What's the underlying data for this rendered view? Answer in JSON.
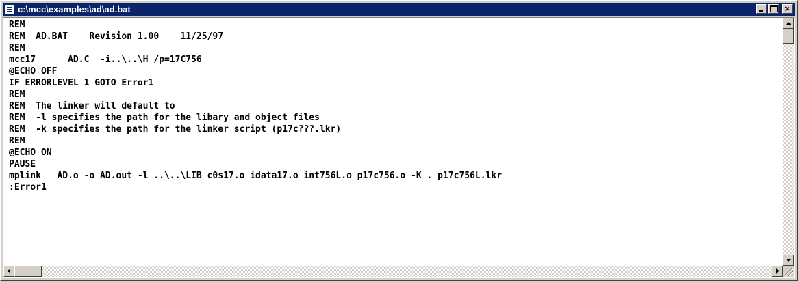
{
  "window": {
    "title": "c:\\mcc\\examples\\ad\\ad.bat",
    "icon": "notepad-icon",
    "buttons": {
      "minimize": "minimize-icon",
      "maximize": "maximize-icon",
      "close": "×"
    }
  },
  "editor": {
    "lines": [
      "REM",
      "REM  AD.BAT    Revision 1.00    11/25/97",
      "REM",
      "mcc17      AD.C  -i..\\..\\H /p=17C756",
      "@ECHO OFF",
      "IF ERRORLEVEL 1 GOTO Error1",
      "REM",
      "REM  The linker will default to",
      "REM  -l specifies the path for the libary and object files",
      "REM  -k specifies the path for the linker script (p17c???.lkr)",
      "REM",
      "@ECHO ON",
      "PAUSE",
      "mplink   AD.o -o AD.out -l ..\\..\\LIB c0s17.o idata17.o int756L.o p17c756.o -K . p17c756L.lkr",
      ":Error1"
    ]
  },
  "colors": {
    "title_bar": "#0a246a",
    "face": "#d4d0c8",
    "text": "#000000"
  }
}
